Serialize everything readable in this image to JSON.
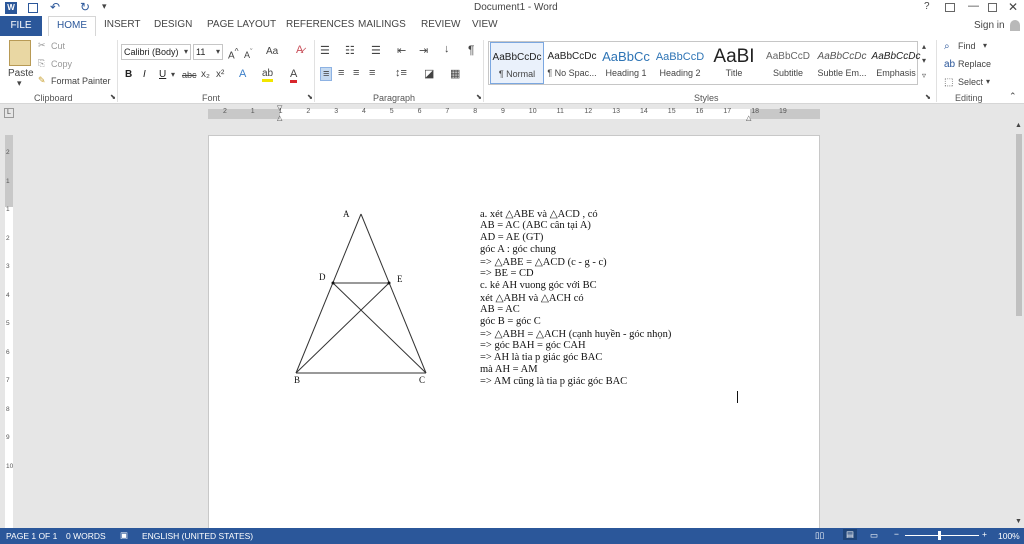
{
  "window": {
    "title": "Document1 - Word",
    "help": "?",
    "sign_in": "Sign in"
  },
  "tabs": [
    "FILE",
    "HOME",
    "INSERT",
    "DESIGN",
    "PAGE LAYOUT",
    "REFERENCES",
    "MAILINGS",
    "REVIEW",
    "VIEW"
  ],
  "clipboard": {
    "paste": "Paste",
    "cut": "Cut",
    "copy": "Copy",
    "format_painter": "Format Painter",
    "label": "Clipboard"
  },
  "font": {
    "name": "Calibri (Body)",
    "size": "11",
    "label": "Font",
    "change_case": "Aa",
    "bold": "B",
    "italic": "I",
    "underline": "U",
    "strike": "abc",
    "subscript": "x₂",
    "superscript": "x²"
  },
  "paragraph": {
    "label": "Paragraph",
    "pilcrow": "¶"
  },
  "styles": {
    "label": "Styles",
    "items": [
      {
        "preview": "AaBbCcDc",
        "name": "¶ Normal"
      },
      {
        "preview": "AaBbCcDc",
        "name": "¶ No Spac..."
      },
      {
        "preview": "AaBbCc",
        "name": "Heading 1"
      },
      {
        "preview": "AaBbCcD",
        "name": "Heading 2"
      },
      {
        "preview": "AaBI",
        "name": "Title"
      },
      {
        "preview": "AaBbCcD",
        "name": "Subtitle"
      },
      {
        "preview": "AaBbCcDc",
        "name": "Subtle Em..."
      },
      {
        "preview": "AaBbCcDc",
        "name": "Emphasis"
      }
    ]
  },
  "editing": {
    "find": "Find",
    "replace": "Replace",
    "select": "Select",
    "label": "Editing"
  },
  "ruler": {
    "marks": [
      "2",
      "1",
      "1",
      "2",
      "3",
      "4",
      "5",
      "6",
      "7",
      "8",
      "9",
      "10",
      "11",
      "12",
      "13",
      "14",
      "15",
      "16",
      "17",
      "18",
      "19"
    ]
  },
  "vruler": {
    "marks": [
      "2",
      "1",
      "1",
      "2",
      "3",
      "4",
      "5",
      "6",
      "7",
      "8",
      "9",
      "10"
    ]
  },
  "figure": {
    "labels": {
      "A": "A",
      "D": "D",
      "E": "E",
      "B": "B",
      "C": "C"
    }
  },
  "document_lines": [
    "a.  xét △ABE và △ACD , có",
    "AB = AC (ABC cân tại A)",
    "AD = AE (GT)",
    "góc A : góc chung",
    "=> △ABE = △ACD (c - g - c)",
    "=> BE = CD",
    "c.  kẻ AH vuong góc với BC",
    "xét △ABH và △ACH có",
    "AB = AC",
    "góc B = góc C",
    "=> △ABH = △ACH (cạnh huyền - góc nhọn)",
    "=> góc BAH = góc CAH",
    "=> AH là tia p giác góc BAC",
    "mà AH = AM",
    "=> AM cũng là tia p giác góc BAC"
  ],
  "status": {
    "page": "PAGE 1 OF 1",
    "words": "0 WORDS",
    "language": "ENGLISH (UNITED STATES)",
    "zoom": "100%"
  }
}
